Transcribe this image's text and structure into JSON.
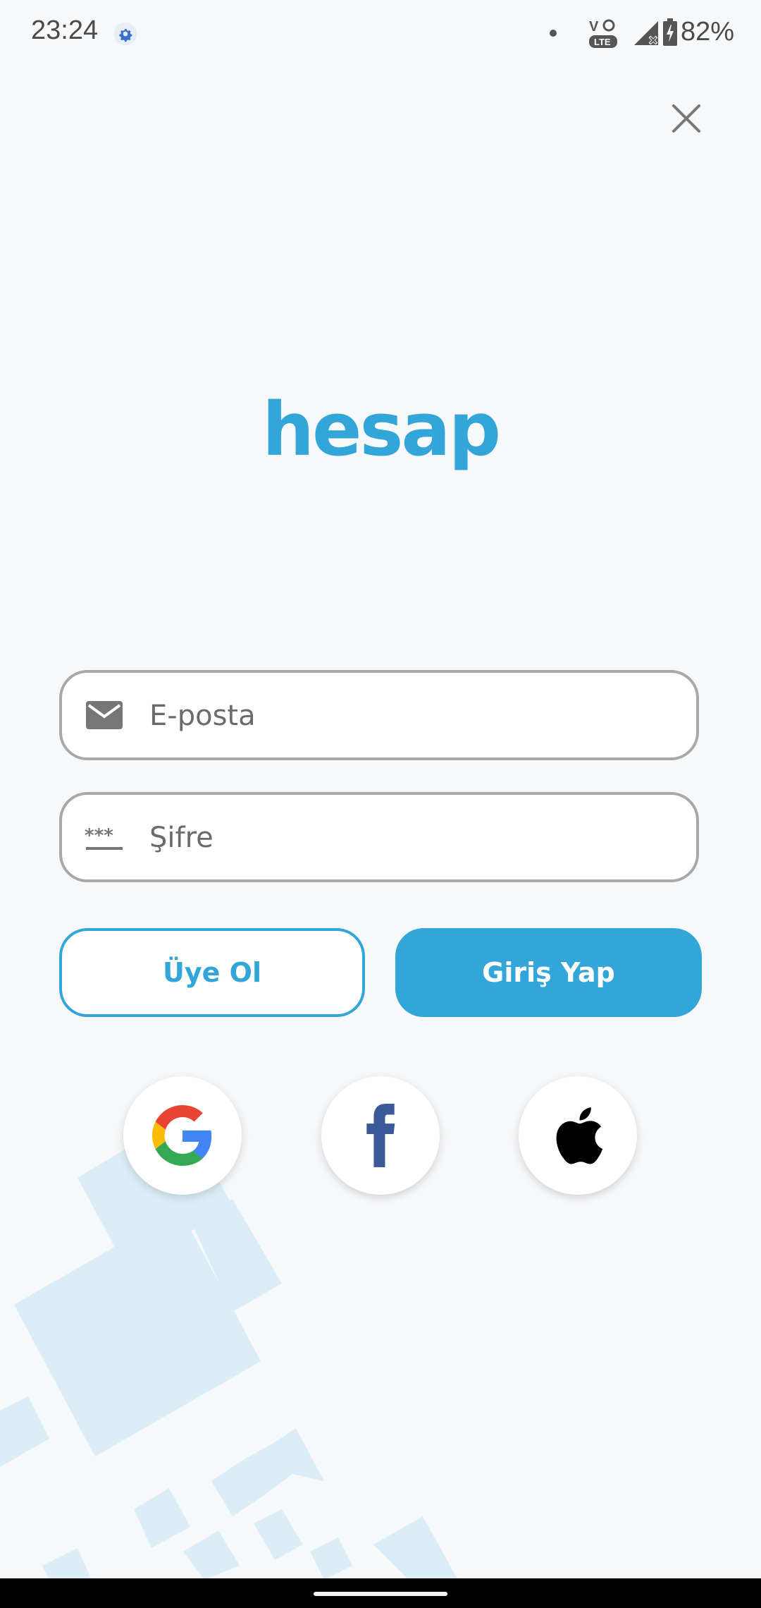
{
  "status_bar": {
    "time": "23:24",
    "battery": "82%",
    "icons": [
      "settings-gear-icon",
      "notification-dot-icon",
      "volte-icon",
      "signal-icon",
      "battery-charging-icon"
    ]
  },
  "close_icon": "close-icon",
  "logo": "hesap",
  "form": {
    "email_placeholder": "E-posta",
    "email_value": "",
    "password_placeholder": "Şifre",
    "password_value": "",
    "email_icon": "envelope-icon",
    "password_icon": "asterisk-password-icon"
  },
  "buttons": {
    "signup": "Üye Ol",
    "login": "Giriş Yap"
  },
  "social": {
    "google": "google-icon",
    "facebook": "facebook-icon",
    "apple": "apple-icon"
  },
  "colors": {
    "accent": "#33a6d9",
    "background": "#f7f8f9",
    "field_border": "#a8a8a8",
    "decor": "#dbeef7",
    "facebook": "#3b5998"
  }
}
